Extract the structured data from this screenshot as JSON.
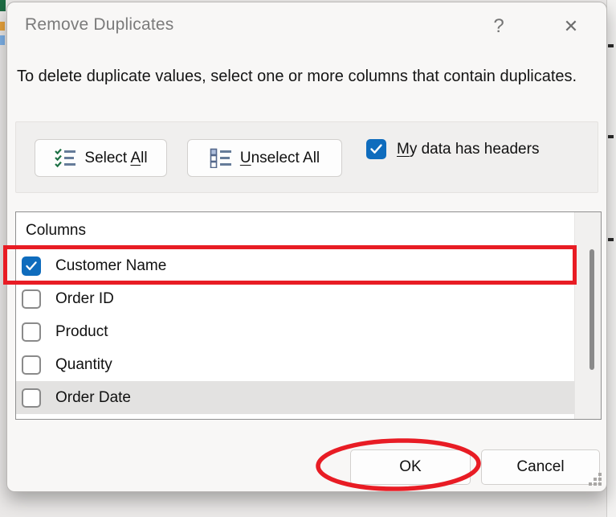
{
  "window": {
    "title": "Remove Duplicates",
    "help_glyph": "?",
    "close_glyph": "✕"
  },
  "description": "To delete duplicate values, select one or more columns that contain duplicates.",
  "toolbar": {
    "select_all": {
      "pre": "Select ",
      "u": "A",
      "post": "ll"
    },
    "unselect_all": {
      "pre": "",
      "u": "U",
      "post": "nselect All"
    },
    "my_data_has_headers": {
      "pre": "",
      "u": "M",
      "post": "y data has headers",
      "checked": true
    }
  },
  "columns": {
    "header": "Columns",
    "items": [
      {
        "label": "Customer Name",
        "checked": true
      },
      {
        "label": "Order ID",
        "checked": false
      },
      {
        "label": "Product",
        "checked": false
      },
      {
        "label": "Quantity",
        "checked": false
      },
      {
        "label": "Order Date",
        "checked": false,
        "highlighted": true
      }
    ]
  },
  "actions": {
    "ok": "OK",
    "cancel": "Cancel"
  },
  "colors": {
    "accent_blue": "#0f6cbd",
    "annotation_red": "#e81c24"
  },
  "annotations": {
    "boxed_item": "Customer Name",
    "circled_button": "OK"
  }
}
